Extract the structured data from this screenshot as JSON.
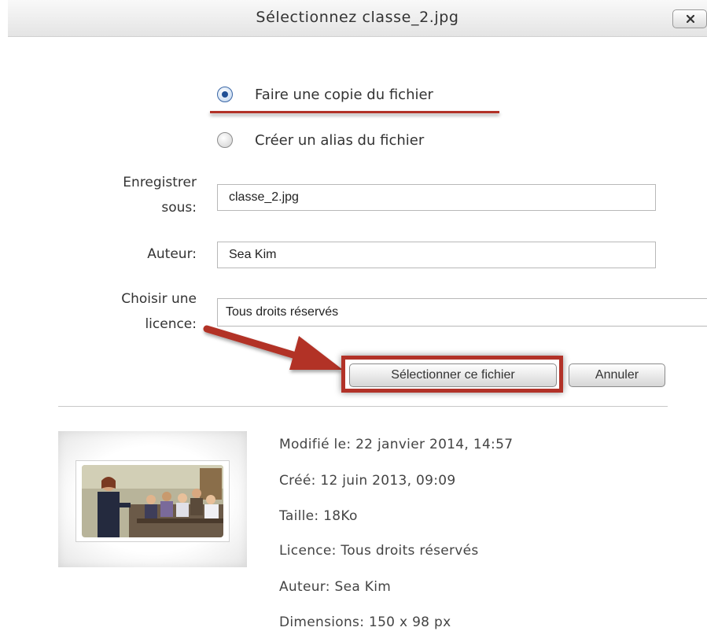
{
  "dialog": {
    "title": "Sélectionnez classe_2.jpg",
    "close_icon": "close-icon"
  },
  "options": [
    {
      "label": "Faire une copie du fichier",
      "checked": true
    },
    {
      "label": "Créer un alias du fichier",
      "checked": false
    }
  ],
  "form": {
    "save_as": {
      "label_line1": "Enregistrer",
      "label_line2": "sous:",
      "value": "classe_2.jpg"
    },
    "author": {
      "label": "Auteur:",
      "value": "Sea Kim"
    },
    "license": {
      "label_line1": "Choisir une",
      "label_line2": "licence:",
      "value": "Tous droits réservés"
    }
  },
  "buttons": {
    "select_label": "Sélectionner ce fichier",
    "cancel_label": "Annuler"
  },
  "file_info": {
    "modified": "Modifié le: 22 janvier 2014, 14:57",
    "created": "Créé: 12 juin 2013, 09:09",
    "size": "Taille: 18Ko",
    "license": "Licence: Tous droits réservés",
    "author": "Auteur: Sea Kim",
    "dimensions": "Dimensions: 150 x 98 px"
  },
  "colors": {
    "annotation_red": "#b23228",
    "radio_selected": "#1f4f95"
  }
}
